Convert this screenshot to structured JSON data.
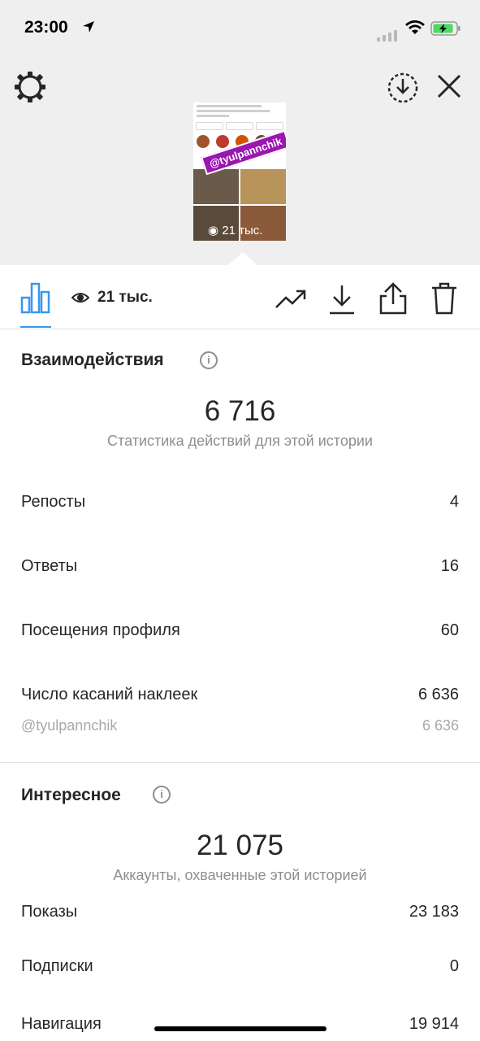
{
  "status_bar": {
    "time": "23:00"
  },
  "preview": {
    "sticker": "@tyulpannchik",
    "views": "21 тыс."
  },
  "toolbar": {
    "views": "21 тыс."
  },
  "interactions": {
    "title": "Взаимодействия",
    "total": "6 716",
    "caption": "Статистика действий для этой истории",
    "rows": [
      {
        "label": "Репосты",
        "value": "4"
      },
      {
        "label": "Ответы",
        "value": "16"
      },
      {
        "label": "Посещения профиля",
        "value": "60"
      },
      {
        "label": "Число касаний наклеек",
        "value": "6 636"
      }
    ],
    "sticker_row": {
      "label": "@tyulpannchik",
      "value": "6 636"
    }
  },
  "discovery": {
    "title": "Интересное",
    "total": "21 075",
    "caption": "Аккаунты, охваченные этой историей",
    "rows": [
      {
        "label": "Показы",
        "value": "23 183"
      },
      {
        "label": "Подписки",
        "value": "0"
      },
      {
        "label": "Навигация",
        "value": "19 914"
      }
    ]
  },
  "colors": {
    "accent": "#3897f0",
    "sticker_bg": "#9b15b0",
    "battery": "#4cd964"
  },
  "icons": [
    "location-arrow-icon",
    "wifi-icon",
    "battery-icon",
    "settings-icon",
    "download-circle-icon",
    "close-icon",
    "bar-chart-icon",
    "eye-icon",
    "trending-icon",
    "download-icon",
    "share-icon",
    "trash-icon",
    "info-icon"
  ]
}
